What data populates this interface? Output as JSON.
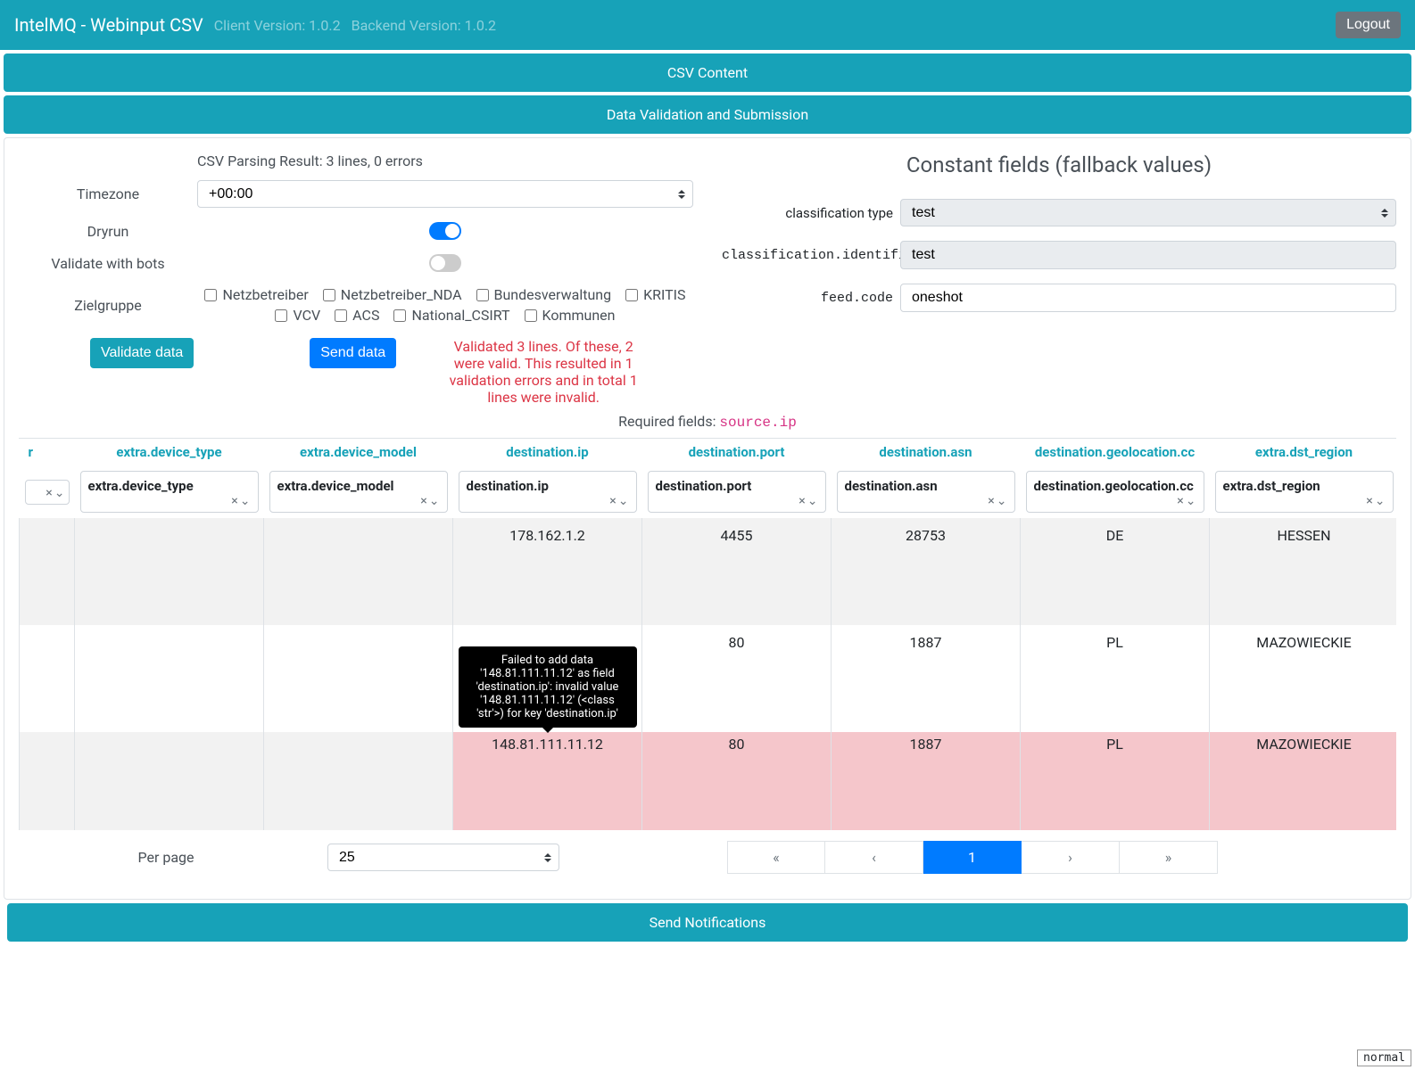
{
  "navbar": {
    "brand": "IntelMQ - Webinput CSV",
    "client_version": "Client Version: 1.0.2",
    "backend_version": "Backend Version: 1.0.2",
    "logout": "Logout"
  },
  "sections": {
    "csv_content": "CSV Content",
    "validation": "Data Validation and Submission"
  },
  "parsing": {
    "result": "CSV Parsing Result: 3 lines, 0 errors",
    "timezone_label": "Timezone",
    "timezone_value": "+00:00",
    "dryrun_label": "Dryrun",
    "dryrun_on": true,
    "validate_bots_label": "Validate with bots",
    "validate_bots_on": false,
    "zielgruppe_label": "Zielgruppe",
    "zielgruppe_options": [
      "Netzbetreiber",
      "Netzbetreiber_NDA",
      "Bundesverwaltung",
      "KRITIS",
      "VCV",
      "ACS",
      "National_CSIRT",
      "Kommunen"
    ],
    "validate_btn": "Validate data",
    "send_btn": "Send data",
    "validation_msg": "Validated 3 lines. Of these, 2 were valid. This resulted in 1 validation errors and in total 1 lines were invalid.",
    "required_label": "Required fields: ",
    "required_field": "source.ip"
  },
  "constants": {
    "title": "Constant fields (fallback values)",
    "classification_type_label": "classification type",
    "classification_type_value": "test",
    "classification_identifier_label": "classification.identifier",
    "classification_identifier_value": "test",
    "feed_code_label": "feed.code",
    "feed_code_value": "oneshot"
  },
  "table": {
    "columns": [
      "r",
      "extra.device_type",
      "extra.device_model",
      "destination.ip",
      "destination.port",
      "destination.asn",
      "destination.geolocation.cc",
      "extra.dst_region"
    ],
    "pills": [
      "",
      "extra.device_type",
      "extra.device_model",
      "destination.ip",
      "destination.port",
      "destination.asn",
      "destination.geolocation.cc",
      "extra.dst_region"
    ],
    "rows": [
      {
        "cells": [
          "",
          "",
          "",
          "178.162.1.2",
          "4455",
          "28753",
          "DE",
          "HESSEN"
        ],
        "error": false
      },
      {
        "cells": [
          "",
          "",
          "",
          "",
          "80",
          "1887",
          "PL",
          "MAZOWIECKIE"
        ],
        "error": false
      },
      {
        "cells": [
          "",
          "",
          "",
          "148.81.111.11.12",
          "80",
          "1887",
          "PL",
          "MAZOWIECKIE"
        ],
        "error": true
      }
    ],
    "tooltip": "Failed to add data '148.81.111.11.12' as field 'destination.ip': invalid value '148.81.111.11.12' (<class 'str'>) for key 'destination.ip'"
  },
  "pager": {
    "per_page_label": "Per page",
    "per_page_value": "25",
    "first": "«",
    "prev": "‹",
    "current": "1",
    "next": "›",
    "last": "»"
  },
  "footer": {
    "send_notifications": "Send Notifications"
  },
  "badge": "normal"
}
